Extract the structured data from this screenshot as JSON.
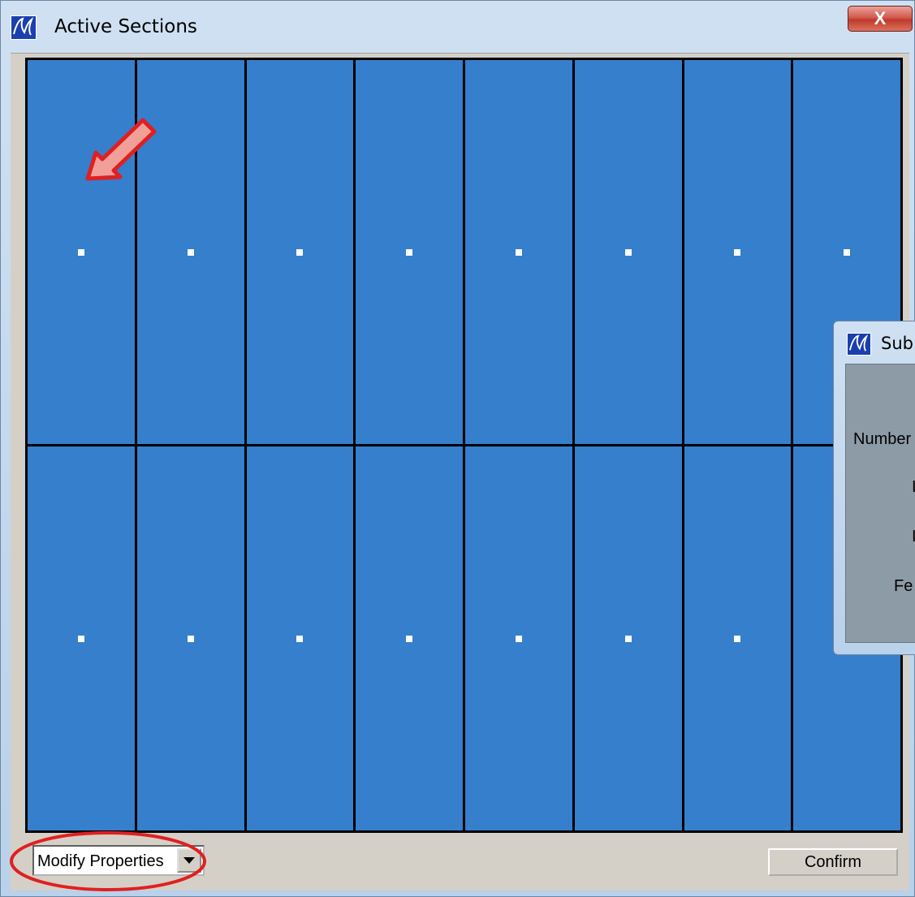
{
  "window": {
    "title": "Active Sections",
    "close_label": "X"
  },
  "grid": {
    "rows": 2,
    "columns": 8,
    "cell_color": "#357fcd",
    "dot_color": "#ffffff"
  },
  "annotation": {
    "arrow_color": "#e02020",
    "ellipse_color": "#e02020"
  },
  "sub_dialog": {
    "title": "Sub",
    "labels": [
      "Number",
      "I",
      "I",
      "Fe"
    ]
  },
  "footer": {
    "mode_select": {
      "value": "Modify Properties"
    },
    "confirm_label": "Confirm"
  }
}
